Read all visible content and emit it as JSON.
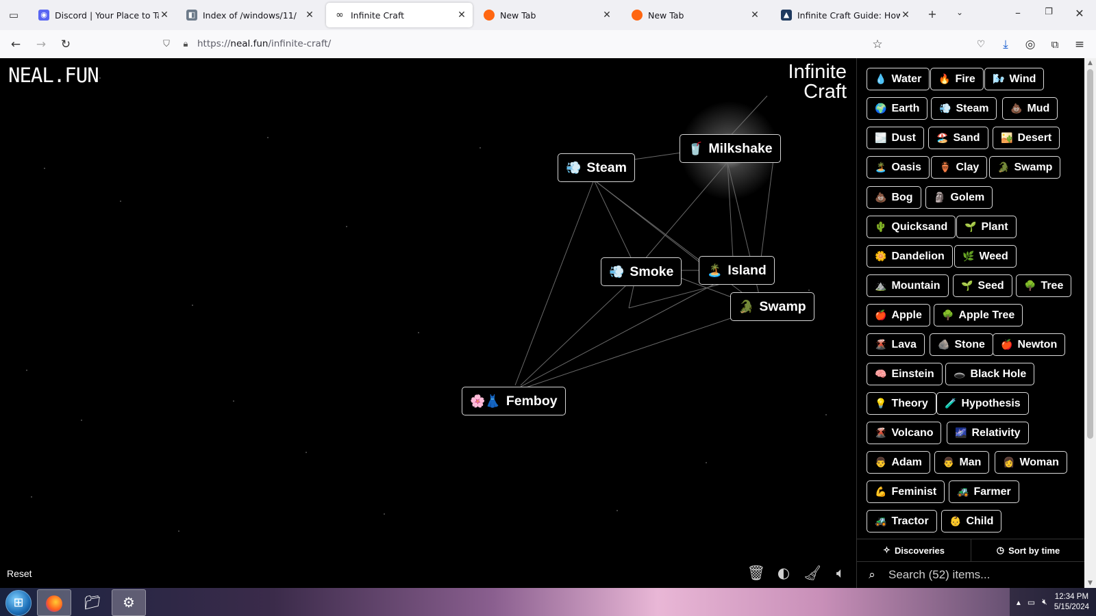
{
  "browser": {
    "tabs": [
      {
        "title": "Discord | Your Place to Talk and Hang Out",
        "favicon": "discord-icon",
        "color": "#5865f2"
      },
      {
        "title": "Index of /windows/11/",
        "favicon": "page-icon",
        "color": "#6c7a89"
      },
      {
        "title": "Infinite Craft",
        "favicon": "infinity-icon",
        "color": "#222222"
      },
      {
        "title": "New Tab",
        "favicon": "firefox-icon",
        "color": "#ff6611"
      },
      {
        "title": "New Tab",
        "favicon": "firefox-icon",
        "color": "#ff6611"
      },
      {
        "title": "Infinite Craft Guide: How to Make Everything",
        "favicon": "guide-icon",
        "color": "#1f3a5f"
      }
    ],
    "url": {
      "scheme": "https://",
      "host": "neal.fun",
      "path": "/infinite-craft/"
    }
  },
  "header": {
    "site_logo": "NEAL.FUN",
    "game_title_line1": "Infinite",
    "game_title_line2": "Craft"
  },
  "canvas": {
    "nodes": [
      {
        "name": "Steam",
        "emoji": "💨"
      },
      {
        "name": "Milkshake",
        "emoji": "🥤"
      },
      {
        "name": "Smoke",
        "emoji": "💨"
      },
      {
        "name": "Island",
        "emoji": "🏝️"
      },
      {
        "name": "Swamp",
        "emoji": "🐊"
      },
      {
        "name": "Femboy",
        "emoji": "🌸👗"
      }
    ],
    "reset_label": "Reset"
  },
  "sidebar": {
    "items": [
      {
        "name": "Water",
        "emoji": "💧"
      },
      {
        "name": "Fire",
        "emoji": "🔥"
      },
      {
        "name": "Wind",
        "emoji": "🌬️"
      },
      {
        "name": "Earth",
        "emoji": "🌍"
      },
      {
        "name": "Steam",
        "emoji": "💨"
      },
      {
        "name": "Mud",
        "emoji": "💩"
      },
      {
        "name": "Dust",
        "emoji": "🌫️"
      },
      {
        "name": "Sand",
        "emoji": "🏖️"
      },
      {
        "name": "Desert",
        "emoji": "🏜️"
      },
      {
        "name": "Oasis",
        "emoji": "🏝️"
      },
      {
        "name": "Clay",
        "emoji": "🏺"
      },
      {
        "name": "Swamp",
        "emoji": "🐊"
      },
      {
        "name": "Bog",
        "emoji": "💩"
      },
      {
        "name": "Golem",
        "emoji": "🗿"
      },
      {
        "name": "Quicksand",
        "emoji": "🌵"
      },
      {
        "name": "Plant",
        "emoji": "🌱"
      },
      {
        "name": "Dandelion",
        "emoji": "🌼"
      },
      {
        "name": "Weed",
        "emoji": "🌿"
      },
      {
        "name": "Mountain",
        "emoji": "⛰️"
      },
      {
        "name": "Seed",
        "emoji": "🌱"
      },
      {
        "name": "Tree",
        "emoji": "🌳"
      },
      {
        "name": "Apple",
        "emoji": "🍎"
      },
      {
        "name": "Apple Tree",
        "emoji": "🌳"
      },
      {
        "name": "Lava",
        "emoji": "🌋"
      },
      {
        "name": "Stone",
        "emoji": "🪨"
      },
      {
        "name": "Newton",
        "emoji": "🍎"
      },
      {
        "name": "Einstein",
        "emoji": "🧠"
      },
      {
        "name": "Black Hole",
        "emoji": "🕳️"
      },
      {
        "name": "Theory",
        "emoji": "💡"
      },
      {
        "name": "Hypothesis",
        "emoji": "🧪"
      },
      {
        "name": "Volcano",
        "emoji": "🌋"
      },
      {
        "name": "Relativity",
        "emoji": "🌌"
      },
      {
        "name": "Adam",
        "emoji": "👨"
      },
      {
        "name": "Man",
        "emoji": "👨"
      },
      {
        "name": "Woman",
        "emoji": "👩"
      },
      {
        "name": "Feminist",
        "emoji": "💪"
      },
      {
        "name": "Farmer",
        "emoji": "🚜"
      },
      {
        "name": "Tractor",
        "emoji": "🚜"
      },
      {
        "name": "Child",
        "emoji": "👶"
      }
    ],
    "tab_discoveries": "Discoveries",
    "tab_sort": "Sort by time",
    "search_placeholder": "Search (52) items..."
  },
  "taskbar": {
    "time": "12:34 PM",
    "date": "5/15/2024"
  }
}
